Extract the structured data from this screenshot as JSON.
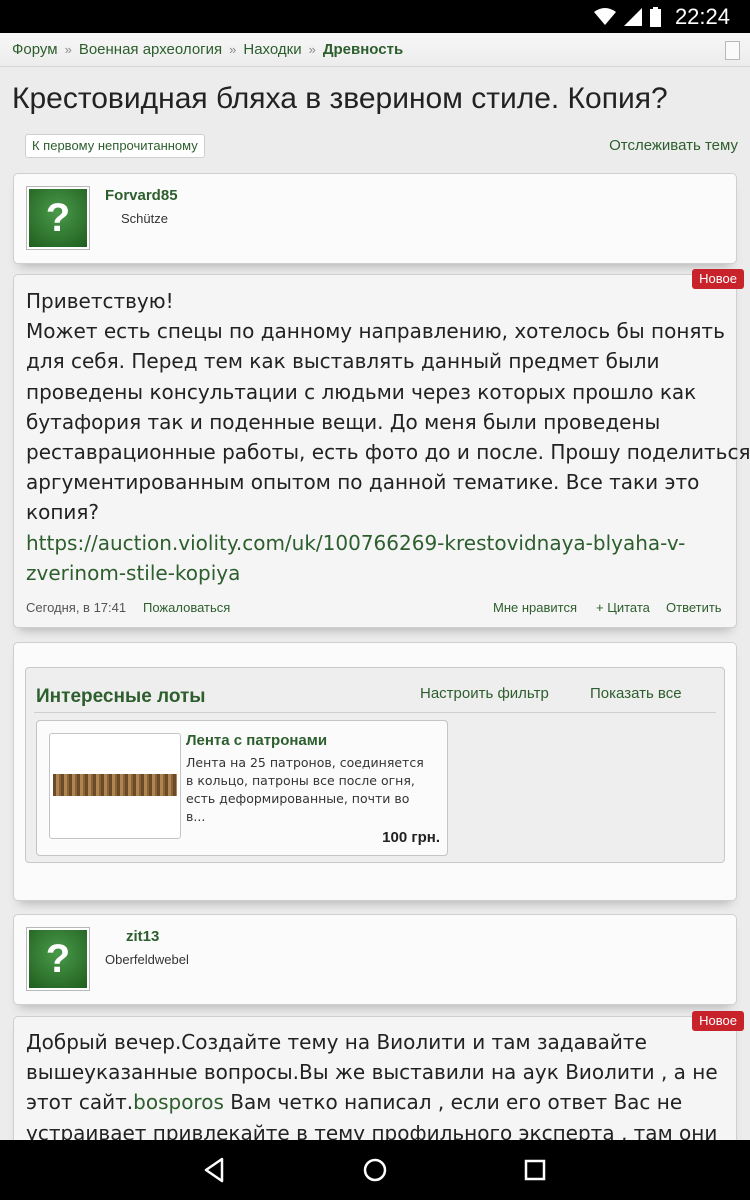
{
  "status_bar": {
    "time": "22:24",
    "icons": [
      "wifi-icon",
      "signal-icon",
      "battery-icon"
    ]
  },
  "breadcrumb": {
    "items": [
      "Форум",
      "Военная археология",
      "Находки"
    ],
    "current": "Древность",
    "separator": "»"
  },
  "thread": {
    "title": "Крестовидная бляха в зверином стиле. Копия?",
    "first_unread_label": "К первому непрочитанному",
    "watch_label": "Отслеживать тему"
  },
  "post1": {
    "user": {
      "name": "Forvard85",
      "title": "Schütze",
      "avatar_glyph": "?"
    },
    "badge": "Новое",
    "lines": [
      "Приветствую!",
      "Может есть спецы по данному направлению, хотелось бы понять",
      "для себя. Перед тем как выставлять данный предмет были",
      "проведены консультации с людьми через которых прошло как",
      "бутафория так и поденные вещи. До меня были проведены",
      "реставрационные работы, есть фото до и после. Прошу поделиться",
      "аргументированным опытом по данной тематике. Все таки это",
      "копия?"
    ],
    "link_lines": [
      "https://auction.violity.com/uk/100766269-krestovidnaya-blyaha-v-",
      "zverinom-stile-kopiya"
    ],
    "date": "Сегодня, в 17:41",
    "report": "Пожаловаться",
    "like": "Мне нравится",
    "quote": "+ Цитата",
    "reply": "Ответить"
  },
  "lots": {
    "title": "Интересные лоты",
    "filter_label": "Настроить фильтр",
    "show_all_label": "Показать все",
    "item": {
      "title": "Лента с патронами",
      "desc_lines": [
        "Лента на 25 патронов, соединяется",
        "в кольцо, патроны все после огня,",
        "есть деформированные, почти во",
        "в..."
      ],
      "price": "100 грн."
    }
  },
  "post2": {
    "user": {
      "name": "zit13",
      "title": "Oberfeldwebel",
      "avatar_glyph": "?"
    },
    "badge": "Новое",
    "line1": "Добрый вечер.Создайте тему на Виолити и там задавайте",
    "line2": "вышеуказанные вопросы.Вы же выставили на аук Виолити , а не",
    "line3_pre": "этот сайт.",
    "line3_link": "bosporos",
    "line3_post": " Вам четко написал , если его ответ Вас не",
    "line4": "устраивает привлекайте в тему профильного эксперта , там они"
  },
  "colors": {
    "accent": "#2d5e2d",
    "badge": "#c8232a",
    "background": "#ececec"
  },
  "nav_bar": {
    "icons": [
      "back-icon",
      "home-icon",
      "recents-icon"
    ]
  }
}
